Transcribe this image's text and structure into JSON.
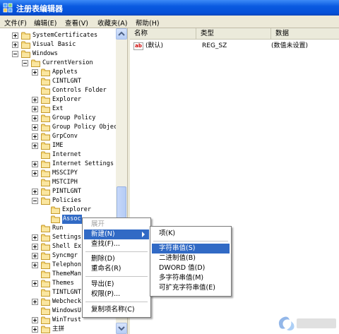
{
  "window": {
    "title": "注册表编辑器"
  },
  "menubar": [
    {
      "label": "文件(F)"
    },
    {
      "label": "编辑(E)"
    },
    {
      "label": "查看(V)"
    },
    {
      "label": "收藏夹(A)"
    },
    {
      "label": "帮助(H)"
    }
  ],
  "tree": {
    "items": [
      {
        "label": "SystemCertificates",
        "expander": "plus"
      },
      {
        "label": "Visual Basic",
        "expander": "plus"
      },
      {
        "label": "Windows",
        "expander": "minus"
      },
      {
        "label": "CurrentVersion",
        "expander": "minus"
      },
      {
        "label": "Applets",
        "expander": "plus"
      },
      {
        "label": "CINTLGNT",
        "expander": "none"
      },
      {
        "label": "Controls Folder",
        "expander": "none"
      },
      {
        "label": "Explorer",
        "expander": "plus"
      },
      {
        "label": "Ext",
        "expander": "plus"
      },
      {
        "label": "Group Policy",
        "expander": "plus"
      },
      {
        "label": "Group Policy Objec",
        "expander": "plus"
      },
      {
        "label": "GrpConv",
        "expander": "plus"
      },
      {
        "label": "IME",
        "expander": "plus"
      },
      {
        "label": "Internet",
        "expander": "none"
      },
      {
        "label": "Internet Settings",
        "expander": "plus"
      },
      {
        "label": "MSSCIPY",
        "expander": "plus"
      },
      {
        "label": "MSTCIPH",
        "expander": "none"
      },
      {
        "label": "PINTLGNT",
        "expander": "plus"
      },
      {
        "label": "Policies",
        "expander": "minus"
      },
      {
        "label": "Explorer",
        "expander": "none"
      },
      {
        "label": "Assoc",
        "expander": "none"
      },
      {
        "label": "Run",
        "expander": "none"
      },
      {
        "label": "Settings",
        "expander": "plus"
      },
      {
        "label": "Shell Ex",
        "expander": "plus"
      },
      {
        "label": "Syncmgr",
        "expander": "plus"
      },
      {
        "label": "Telephon",
        "expander": "plus"
      },
      {
        "label": "ThemeMan",
        "expander": "none"
      },
      {
        "label": "Themes",
        "expander": "plus"
      },
      {
        "label": "TINTLGNT",
        "expander": "none"
      },
      {
        "label": "Webcheck",
        "expander": "plus"
      },
      {
        "label": "WindowsU",
        "expander": "none"
      },
      {
        "label": "WinTrust",
        "expander": "plus"
      },
      {
        "label": "主拼",
        "expander": "plus"
      },
      {
        "label": "",
        "expander": "plus"
      }
    ]
  },
  "list": {
    "columns": [
      {
        "label": "名称"
      },
      {
        "label": "类型"
      },
      {
        "label": "数据"
      }
    ],
    "rows": [
      {
        "name": "(默认)",
        "type": "REG_SZ",
        "data": "(数值未设置)"
      }
    ]
  },
  "context_menu": {
    "items": [
      {
        "label": "展开",
        "state": "disabled"
      },
      {
        "label": "新建(N)",
        "state": "highlighted"
      },
      {
        "label": "查找(F)...",
        "state": "normal"
      },
      {
        "label": "删除(D)",
        "state": "normal"
      },
      {
        "label": "重命名(R)",
        "state": "normal"
      },
      {
        "label": "导出(E)",
        "state": "normal"
      },
      {
        "label": "权限(P)...",
        "state": "normal"
      },
      {
        "label": "复制项名称(C)",
        "state": "normal"
      }
    ]
  },
  "submenu": {
    "items": [
      {
        "label": "项(K)",
        "state": "normal"
      },
      {
        "label": "字符串值(S)",
        "state": "highlighted"
      },
      {
        "label": "二进制值(B)",
        "state": "normal"
      },
      {
        "label": "DWORD 值(D)",
        "state": "normal"
      },
      {
        "label": "多字符串值(M)",
        "state": "normal"
      },
      {
        "label": "可扩充字符串值(E)",
        "state": "normal"
      }
    ]
  },
  "colors": {
    "selection": "#316ac5",
    "titlebar": "#0a5ae0",
    "chrome": "#ece9d8"
  }
}
